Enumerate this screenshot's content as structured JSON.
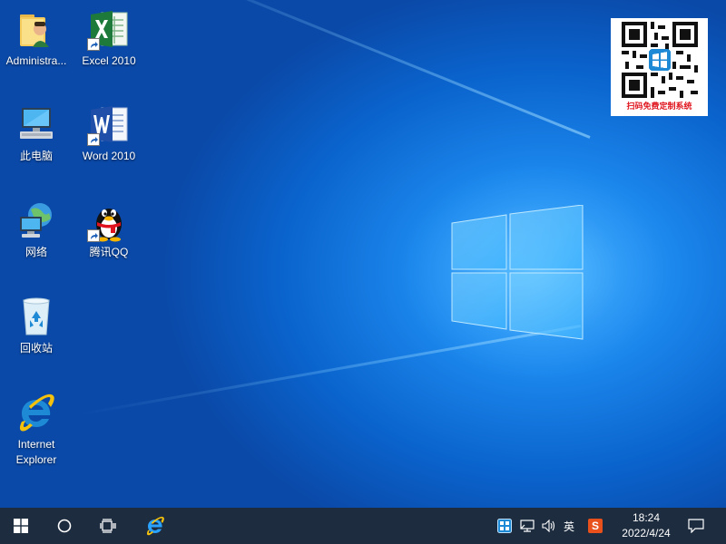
{
  "desktop": {
    "icons": [
      {
        "label": "Administra...",
        "icon": "user-folder-icon"
      },
      {
        "label": "Excel 2010",
        "icon": "excel-icon"
      },
      {
        "label": "此电脑",
        "icon": "computer-icon"
      },
      {
        "label": "Word 2010",
        "icon": "word-icon"
      },
      {
        "label": "网络",
        "icon": "network-icon"
      },
      {
        "label": "腾讯QQ",
        "icon": "qq-penguin-icon"
      },
      {
        "label": "回收站",
        "icon": "recycle-bin-icon"
      },
      {
        "label": "Internet Explorer",
        "icon": "internet-explorer-icon"
      }
    ]
  },
  "widget": {
    "caption": "扫码免费定制系统",
    "accent": "#e0161f"
  },
  "taskbar": {
    "background": "#1d2c3f",
    "start_icon": "windows-start-icon",
    "search_icon": "cortana-circle-icon",
    "taskview_icon": "task-view-icon",
    "pinned_icon": "internet-explorer-icon",
    "tray": {
      "language": "英",
      "ime_label": "S",
      "time": "18:24",
      "date": "2022/4/24"
    }
  },
  "colors": {
    "wallpaper_accent": "#1b86ec",
    "ie_blue": "#1e8ad6",
    "excel_green": "#1d7a3a",
    "word_blue": "#1f4fa8",
    "sogou_orange": "#e8501c"
  }
}
